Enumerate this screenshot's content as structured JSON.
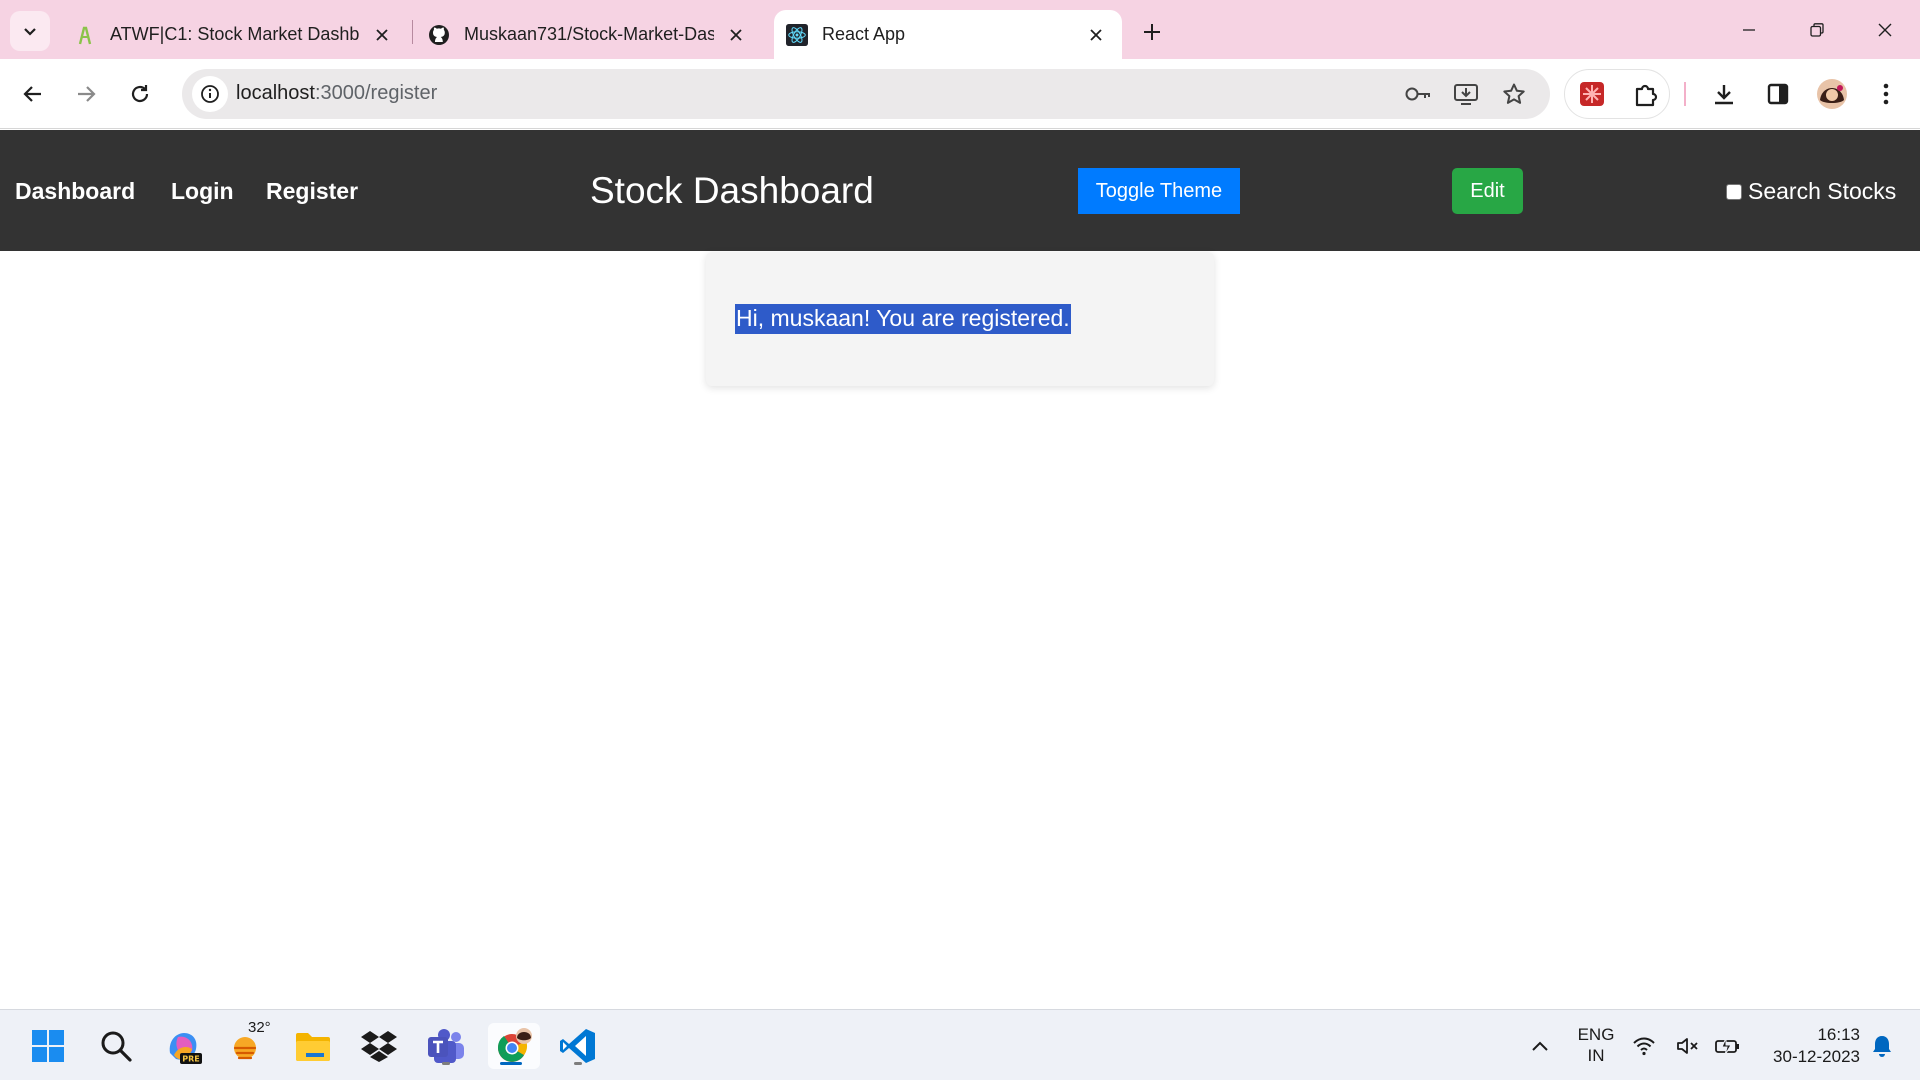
{
  "browser": {
    "tabs": [
      {
        "title": "ATWF|C1: Stock Market Dashbo",
        "icon": "atwf-favicon"
      },
      {
        "title": "Muskaan731/Stock-Market-Das",
        "icon": "github-icon"
      },
      {
        "title": "React App",
        "icon": "react-icon"
      }
    ],
    "url_host": "localhost",
    "url_path": ":3000/register"
  },
  "navbar": {
    "links": [
      "Dashboard",
      "Login",
      "Register"
    ],
    "brand": "Stock Dashboard",
    "toggle_theme_label": "Toggle Theme",
    "edit_label": "Edit",
    "search_label": "Search Stocks"
  },
  "content": {
    "message": "Hi, muskaan! You are registered."
  },
  "taskbar": {
    "weather_temp": "32°",
    "lang_line1": "ENG",
    "lang_line2": "IN",
    "time": "16:13",
    "date": "30-12-2023"
  },
  "colors": {
    "tabstrip": "#f6d3e3",
    "navbar": "#333333",
    "toggle_button": "#007bff",
    "edit_button": "#28a745",
    "selection": "#2e5bc9"
  }
}
